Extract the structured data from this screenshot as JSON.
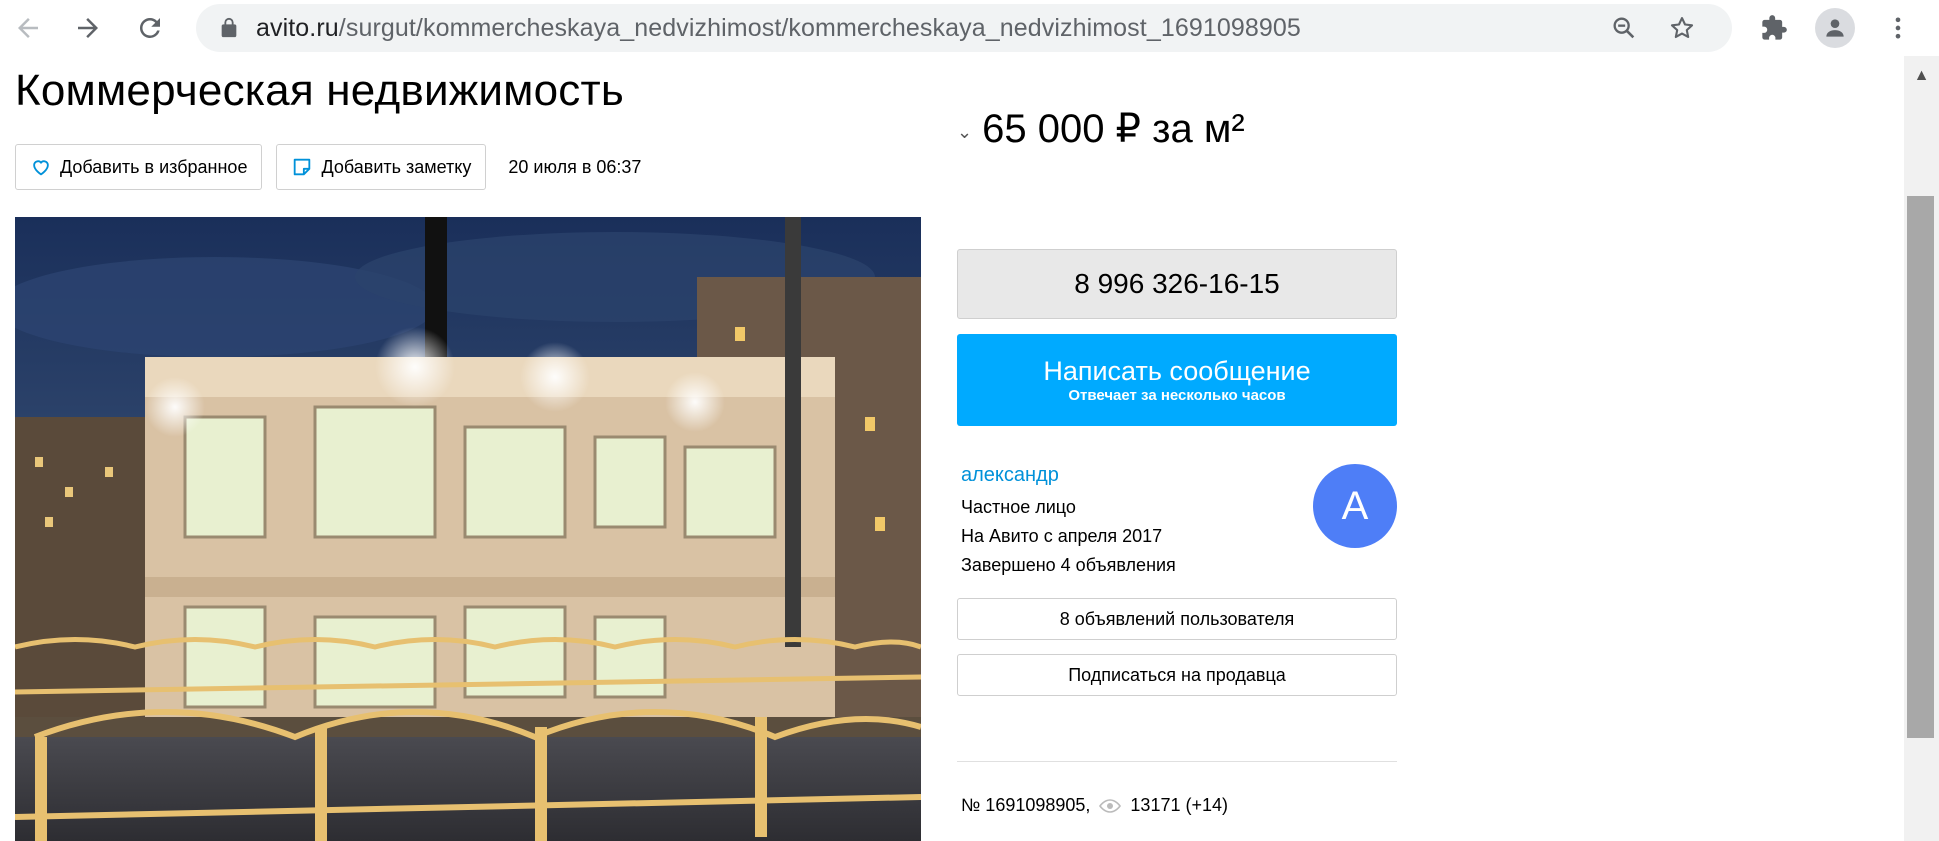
{
  "browser": {
    "url_host": "avito.ru",
    "url_path": "/surgut/kommercheskaya_nedvizhimost/kommercheskaya_nedvizhimost_1691098905"
  },
  "listing": {
    "title": "Коммерческая недвижимость",
    "price": "65 000 ₽ за м²",
    "date": "20 июля в 06:37",
    "number": "№ 1691098905,",
    "views": "13171 (+14)"
  },
  "actions": {
    "favorite_label": "Добавить в избранное",
    "note_label": "Добавить заметку"
  },
  "contact": {
    "phone": "8 996 326-16-15",
    "message_label": "Написать сообщение",
    "message_sub": "Отвечает за несколько часов"
  },
  "seller": {
    "name": "александр",
    "type": "Частное лицо",
    "since": "На Авито с апреля 2017",
    "completed": "Завершено 4 объявления",
    "avatar_letter": "А",
    "ads_label": "8 объявлений пользователя",
    "subscribe_label": "Подписаться на продавца"
  },
  "colors": {
    "accent_blue": "#00aaff",
    "link_blue": "#0091d9",
    "avatar_blue": "#4e7ef7"
  },
  "icons": {
    "back": "arrow-left-icon",
    "forward": "arrow-right-icon",
    "reload": "reload-icon",
    "lock": "lock-icon",
    "zoom": "zoom-out-icon",
    "bookmark": "star-icon",
    "extensions": "puzzle-icon",
    "profile": "person-icon",
    "menu": "kebab-menu-icon",
    "favorite": "heart-icon",
    "note": "note-icon",
    "views": "eye-icon"
  }
}
